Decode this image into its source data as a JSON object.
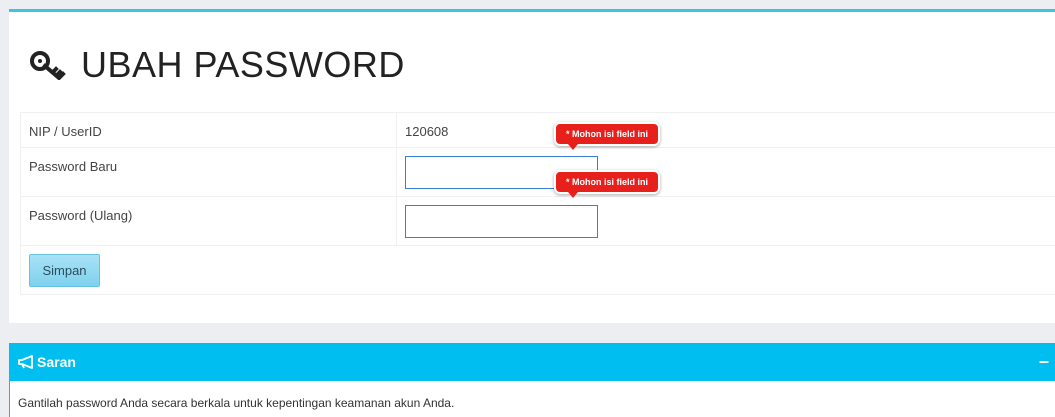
{
  "page": {
    "title": "UBAH PASSWORD",
    "title_icon": "key-icon"
  },
  "form": {
    "rows": [
      {
        "label": "NIP / UserID",
        "value": "120608"
      },
      {
        "label": "Password Baru",
        "value": ""
      },
      {
        "label": "Password (Ulang)",
        "value": ""
      }
    ],
    "validation_message": "* Mohon isi field ini",
    "submit_label": "Simpan"
  },
  "saran": {
    "title": "Saran",
    "icon": "megaphone-icon",
    "collapse_symbol": "–",
    "text": "Gantilah password Anda secara berkala untuk kepentingan keamanan akun Anda."
  },
  "colors": {
    "accent": "#00bff0",
    "error": "#e8201c",
    "input_border": "#3b7ddd"
  }
}
